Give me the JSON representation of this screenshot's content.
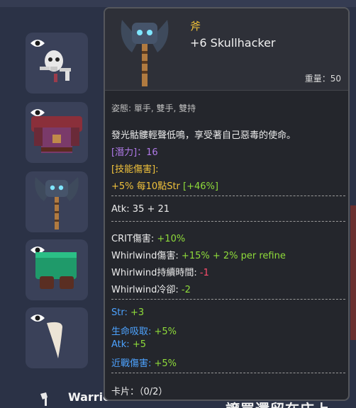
{
  "inventory": {
    "slots": [
      {
        "name": "skull-creature",
        "visible_icon": "eye-icon"
      },
      {
        "name": "chest-armor",
        "visible_icon": "eye-icon"
      },
      {
        "name": "skullhacker-axe",
        "visible_icon": ""
      },
      {
        "name": "green-pants",
        "visible_icon": "eye-icon"
      },
      {
        "name": "bone-fang",
        "visible_icon": "eye-icon"
      }
    ]
  },
  "bottom": {
    "class_label": "Warrio",
    "partial_text": "譲買還留在庄上"
  },
  "tooltip": {
    "type": "斧",
    "name": "+6 Skullhacker",
    "weight_label": "重量：",
    "weight_value": "50",
    "stance": "姿態: 單手, 雙手, 雙持",
    "description": "發光骷髏輕聲低鳴，享受著自己惡毒的使命。",
    "potential_label": "[潛力]：",
    "potential_value": "16",
    "skill_damage_label": "[技能傷害]:",
    "skill_damage_text": "+5% 每10點Str ",
    "skill_damage_bonus": "[+46%]",
    "atk_label": "Atk: 35 + 21",
    "crit_label": "CRIT傷害: ",
    "crit_value": "+10%",
    "whirl_dmg_label": "Whirlwind傷害: ",
    "whirl_dmg_value": "+15% + 2% per refine",
    "whirl_dur_label": "Whirlwind持續時間: ",
    "whirl_dur_value": "-1",
    "whirl_cd_label": "Whirlwind冷卻: ",
    "whirl_cd_value": "-2",
    "str_label": "Str: ",
    "str_value": "+3",
    "lifesteal_label": "生命吸取: ",
    "lifesteal_value": "+5%",
    "atk2_label": "Atk: ",
    "atk2_value": "+5",
    "melee_label": "近戰傷害: ",
    "melee_value": "+5%",
    "card_label": "卡片：（0/2）"
  },
  "colors": {
    "background": "#2b3246",
    "tooltip_bg": "#24262c",
    "gold": "#f0c23c",
    "green": "#8fdc3a",
    "red": "#ff4d6d",
    "blue": "#4da3ff",
    "purple": "#b07ae8"
  }
}
